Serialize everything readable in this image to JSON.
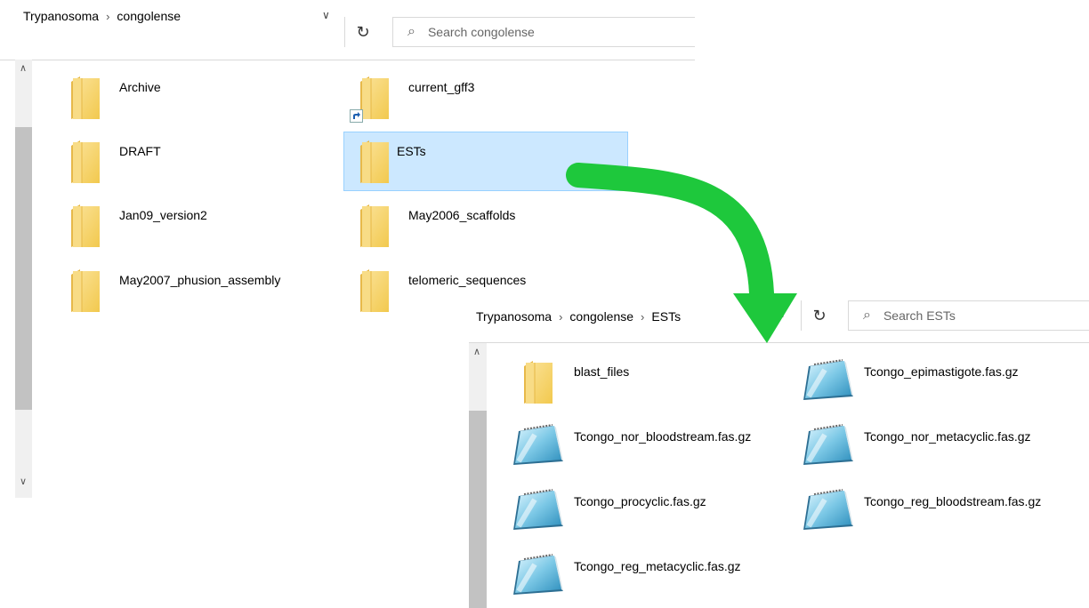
{
  "window1": {
    "breadcrumb": [
      "Trypanosoma",
      "congolense"
    ],
    "search_placeholder": "Search congolense",
    "items": [
      {
        "label": "Archive",
        "type": "folder"
      },
      {
        "label": "current_gff3",
        "type": "folder-shortcut"
      },
      {
        "label": "DRAFT",
        "type": "folder"
      },
      {
        "label": "ESTs",
        "type": "folder",
        "selected": true
      },
      {
        "label": "Jan09_version2",
        "type": "folder"
      },
      {
        "label": "May2006_scaffolds",
        "type": "folder"
      },
      {
        "label": "May2007_phusion_assembly",
        "type": "folder"
      },
      {
        "label": "telomeric_sequences",
        "type": "folder"
      }
    ]
  },
  "window2": {
    "breadcrumb": [
      "Trypanosoma",
      "congolense",
      "ESTs"
    ],
    "search_placeholder": "Search ESTs",
    "items": [
      {
        "label": "blast_files",
        "type": "folder"
      },
      {
        "label": "Tcongo_epimastigote.fas.gz",
        "type": "notepad-file"
      },
      {
        "label": "Tcongo_nor_bloodstream.fas.gz",
        "type": "notepad-file"
      },
      {
        "label": "Tcongo_nor_metacyclic.fas.gz",
        "type": "notepad-file"
      },
      {
        "label": "Tcongo_procyclic.fas.gz",
        "type": "notepad-file"
      },
      {
        "label": "Tcongo_reg_bloodstream.fas.gz",
        "type": "notepad-file"
      },
      {
        "label": "Tcongo_reg_metacyclic.fas.gz",
        "type": "notepad-file"
      }
    ]
  },
  "icons": {
    "breadcrumb_separator": "chevron-right-icon",
    "dropdown": "chevron-down-icon",
    "refresh": "refresh-icon",
    "search": "search-icon",
    "scroll_up": "scroll-up-icon",
    "scroll_down": "scroll-down-icon",
    "navigation_arrow": "green-curved-arrow"
  },
  "colors": {
    "selection_bg": "#cce8ff",
    "selection_border": "#99d1ff",
    "arrow": "#1ec83c",
    "folder": "#f6d77a"
  }
}
